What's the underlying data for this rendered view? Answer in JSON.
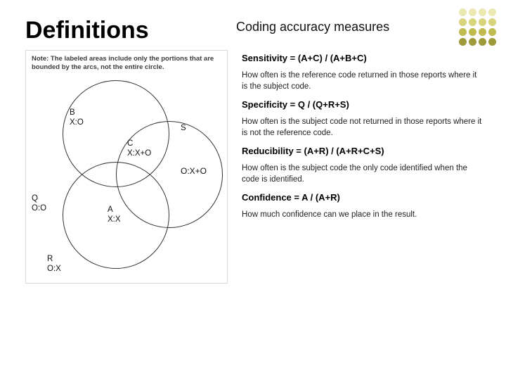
{
  "title": "Definitions",
  "subtitle": "Coding accuracy measures",
  "note": "Note: The labeled areas include only the portions that are bounded by the arcs, not the entire circle.",
  "venn": {
    "B": {
      "name": "B",
      "val": "X:O"
    },
    "S": {
      "name": "S",
      "val": "O:X+O"
    },
    "C": {
      "name": "C",
      "val": "X:X+O"
    },
    "Q": {
      "name": "Q",
      "val": "O:O"
    },
    "A": {
      "name": "A",
      "val": "X:X"
    },
    "R": {
      "name": "R",
      "val": "O:X"
    }
  },
  "measures": [
    {
      "title": "Sensitivity = (A+C) / (A+B+C)",
      "desc": "How often is the reference code returned in those reports where it is the subject code."
    },
    {
      "title": "Specificity = Q / (Q+R+S)",
      "desc": "How often is the subject code not returned in those reports where it is not the reference code."
    },
    {
      "title": "Reducibility = (A+R) / (A+R+C+S)",
      "desc": "How often is the subject code the only code identified when the code is identified."
    },
    {
      "title": "Confidence = A / (A+R)",
      "desc": "How much confidence can we place in the result."
    }
  ]
}
